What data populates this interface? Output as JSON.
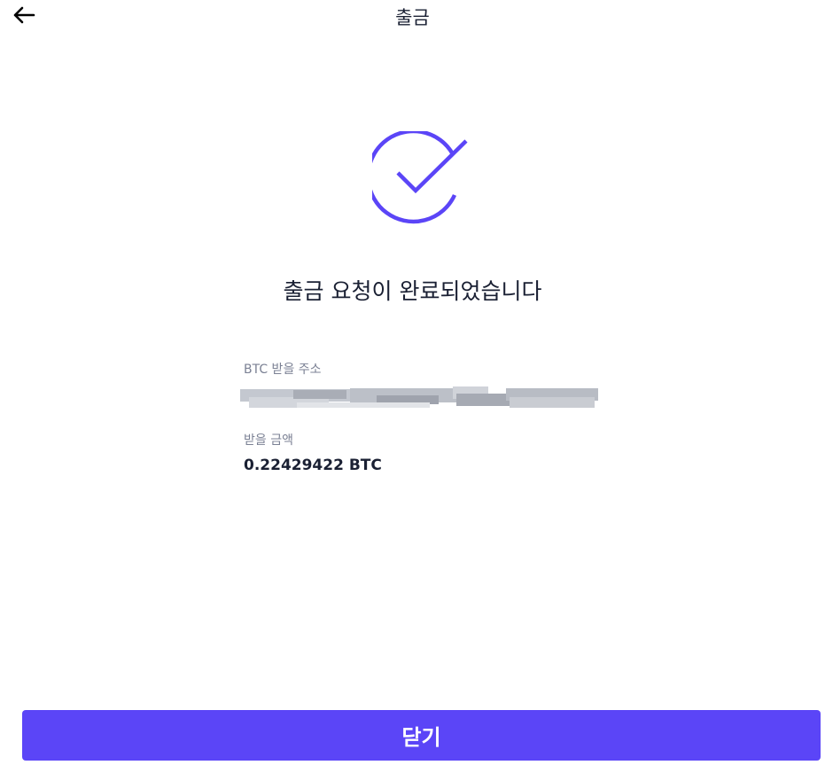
{
  "header": {
    "title": "출금",
    "back_icon": "arrow-left-icon"
  },
  "status": {
    "icon": "check-circle-icon",
    "accent_color": "#5b45f7",
    "message": "출금 요청이 완료되었습니다"
  },
  "details": {
    "address_label": "BTC 받을 주소",
    "address_value": "",
    "amount_label": "받을 금액",
    "amount_value": "0.22429422 BTC"
  },
  "actions": {
    "close_label": "닫기",
    "button_color": "#5b45f7"
  }
}
